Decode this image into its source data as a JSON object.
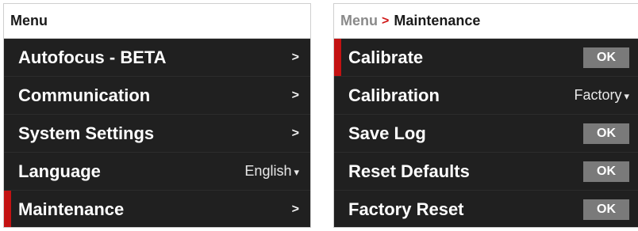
{
  "colors": {
    "accent": "#c41212",
    "panel_bg": "#202020",
    "titlebar_bg": "#ffffff",
    "ok_button_bg": "#7a7a7a"
  },
  "left_panel": {
    "title": "Menu",
    "selected_item": "Maintenance",
    "items": [
      {
        "label": "Autofocus - BETA",
        "control": "arrow",
        "arrow": ">"
      },
      {
        "label": "Communication",
        "control": "arrow",
        "arrow": ">"
      },
      {
        "label": "System Settings",
        "control": "arrow",
        "arrow": ">"
      },
      {
        "label": "Language",
        "control": "dropdown",
        "value": "English",
        "caret": "▾"
      },
      {
        "label": "Maintenance",
        "control": "arrow",
        "arrow": ">"
      }
    ]
  },
  "right_panel": {
    "breadcrumb": {
      "root": "Menu",
      "separator": ">",
      "current": "Maintenance"
    },
    "selected_item": "Calibrate",
    "items": [
      {
        "label": "Calibrate",
        "control": "button",
        "button_label": "OK"
      },
      {
        "label": "Calibration",
        "control": "dropdown",
        "value": "Factory",
        "caret": "▾"
      },
      {
        "label": "Save Log",
        "control": "button",
        "button_label": "OK"
      },
      {
        "label": "Reset Defaults",
        "control": "button",
        "button_label": "OK"
      },
      {
        "label": "Factory Reset",
        "control": "button",
        "button_label": "OK"
      }
    ]
  }
}
